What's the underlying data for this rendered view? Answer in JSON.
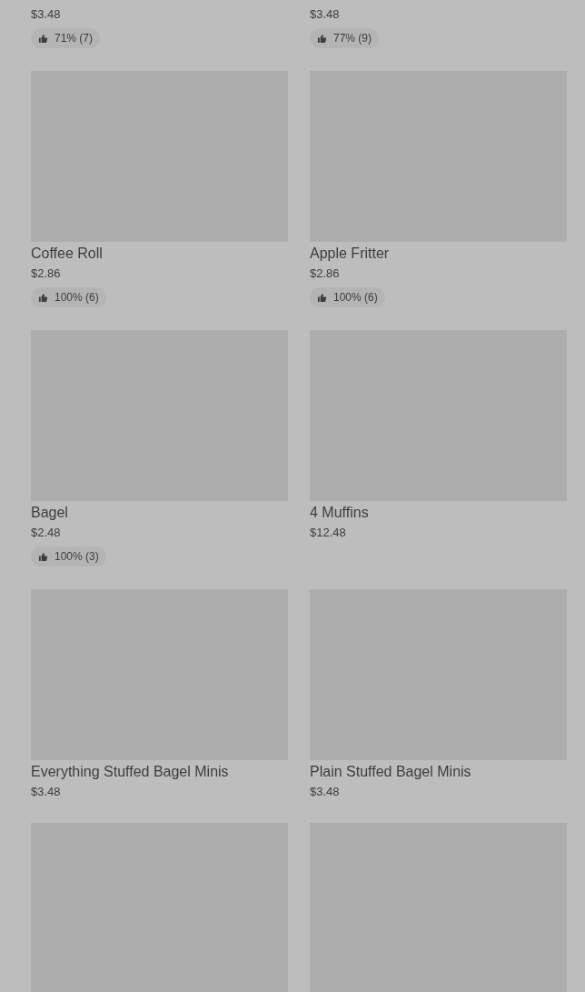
{
  "products": [
    {
      "price": "$3.48",
      "rating": "71% (7)"
    },
    {
      "price": "$3.48",
      "rating": "77% (9)"
    },
    {
      "image": {
        "kind": "picture"
      },
      "name": "Coffee Roll",
      "price": "$2.86",
      "rating": "100% (6)"
    },
    {
      "image": {
        "kind": "picture"
      },
      "name": "Apple Fritter",
      "price": "$2.86",
      "rating": "100% (6)"
    },
    {
      "image": {
        "kind": "picture"
      },
      "name": "Bagel",
      "price": "$2.48",
      "rating": "100% (3)"
    },
    {
      "image": {
        "kind": "picture"
      },
      "name": "4 Muffins",
      "price": "$12.48"
    },
    {
      "image": {
        "kind": "picture"
      },
      "name": "Everything Stuffed Bagel Minis",
      "price": "$3.48"
    },
    {
      "image": {
        "kind": "picture"
      },
      "name": "Plain Stuffed Bagel Minis",
      "price": "$3.48"
    },
    {
      "image": {
        "kind": "picture"
      }
    },
    {
      "image": {
        "kind": "picture"
      }
    }
  ]
}
